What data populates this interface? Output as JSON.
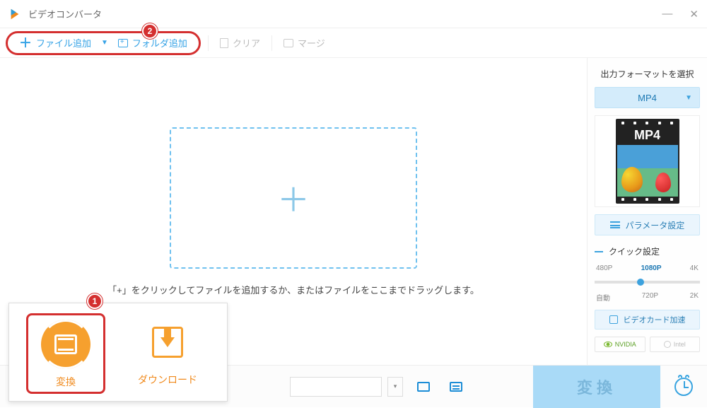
{
  "titlebar": {
    "title": "ビデオコンバータ"
  },
  "toolbar": {
    "add_file": "ファイル追加",
    "add_folder": "フォルダ追加",
    "clear": "クリア",
    "merge": "マージ"
  },
  "dropzone": {
    "hint": "「+」をクリックしてファイルを追加するか、またはファイルをここまでドラッグします。"
  },
  "rightpanel": {
    "title": "出力フォーマットを選択",
    "format_selected": "MP4",
    "thumb_label": "MP4",
    "param_settings": "パラメータ設定",
    "quick_settings": "クイック設定",
    "resolutions_top": {
      "r1": "480P",
      "r2": "1080P",
      "r3": "4K"
    },
    "resolutions_bot": {
      "r1": "自動",
      "r2": "720P",
      "r3": "2K"
    },
    "gpu_accel": "ビデオカード加速",
    "vendor_nvidia": "NVIDIA",
    "vendor_intel": "Intel"
  },
  "modes": {
    "convert": "変換",
    "download": "ダウンロード"
  },
  "bottom": {
    "convert_btn": "変換"
  },
  "annotations": {
    "badge1": "1",
    "badge2": "2"
  }
}
